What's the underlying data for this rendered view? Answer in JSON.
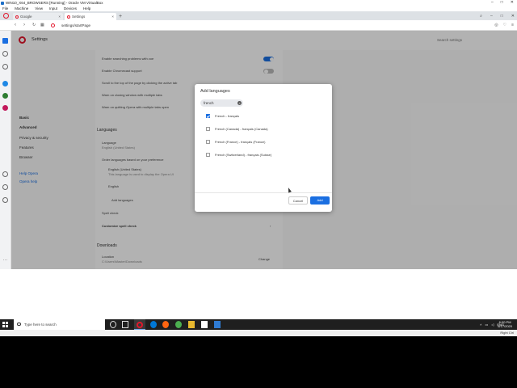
{
  "vbox": {
    "title": "WIN10_X64_BROWSERS [Running] - Oracle VM VirtualBox",
    "controls": [
      "–",
      "□",
      "✕"
    ],
    "menu": [
      "File",
      "Machine",
      "View",
      "Input",
      "Devices",
      "Help"
    ],
    "status_right": "Right Ctrl"
  },
  "browser": {
    "tabs": [
      {
        "label": "Google"
      },
      {
        "label": "Settings"
      }
    ],
    "new_tab": "+",
    "url": "settings/startPage"
  },
  "settings": {
    "title": "Settings",
    "search_placeholder": "Search settings",
    "nav": {
      "basic": "Basic",
      "advanced": "Advanced",
      "privacy": "Privacy & security",
      "features": "Features",
      "browser": "Browser",
      "help_opera": "Help Opera",
      "opera_help": "Opera help"
    },
    "rows": [
      "Enable searching problems with zoe",
      "Enable Chromecast support",
      "Scroll to the top of the page by clicking the active tab",
      "Warn on closing window with multiple tabs",
      "Warn on quitting Opera with multiple tabs open"
    ],
    "languages_section": "Languages",
    "language_label": "Language",
    "language_value": "English (United States)",
    "order_label": "Order languages based on your preference",
    "lang_1": "English (United States)",
    "lang_1_note": "This language is used to display the Opera UI",
    "lang_2": "English",
    "add_languages": "Add languages",
    "spell_check": "Spell check",
    "customize_spell": "Customize spell check",
    "downloads_section": "Downloads",
    "location_label": "Location",
    "location_value": "C:\\Users\\Master\\Downloads",
    "change_button": "Change"
  },
  "dialog": {
    "title": "Add languages",
    "search_value": "french",
    "languages": [
      {
        "label": "French - français",
        "checked": true
      },
      {
        "label": "French (Canada) - français (Canada)",
        "checked": false
      },
      {
        "label": "French (France) - français (France)",
        "checked": false
      },
      {
        "label": "French (Switzerland) - français (Suisse)",
        "checked": false
      }
    ],
    "cancel": "Cancel",
    "add": "Add"
  },
  "taskbar": {
    "search_placeholder": "Type here to search",
    "language": "ENG",
    "time": "6:00 PM",
    "date": "6/17/2020"
  },
  "colors": {
    "accent": "#1b6fe1",
    "opera_red": "#e3182d"
  }
}
